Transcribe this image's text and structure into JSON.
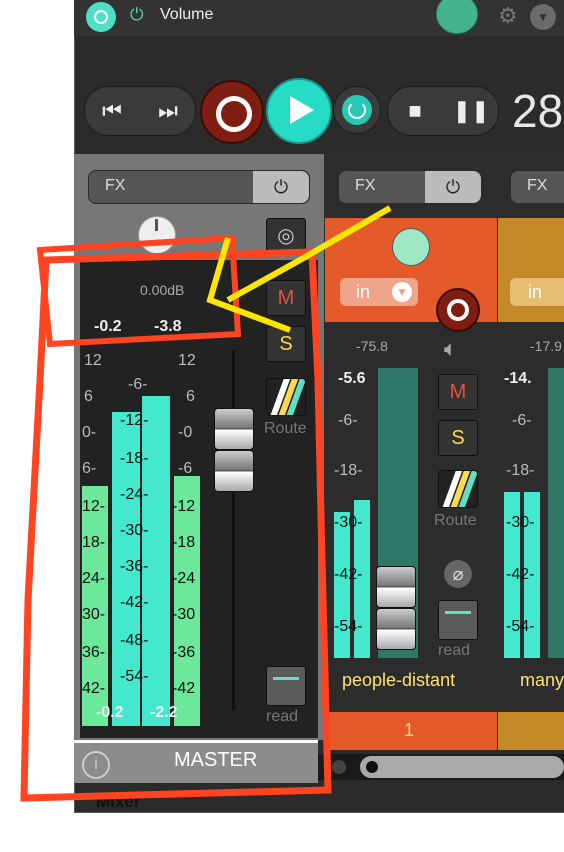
{
  "topbar": {
    "label": "Volume",
    "power_icon": "power-icon",
    "gear_icon": "gear-icon"
  },
  "transport": {
    "time": "28"
  },
  "master": {
    "fx_label": "FX",
    "db": "0.00dB",
    "peaks": [
      "-0.2",
      "-3.8"
    ],
    "bottom_peaks": [
      "-0.2",
      "-2.2"
    ],
    "mute": "M",
    "solo": "S",
    "route": "Route",
    "read": "read",
    "name": "MASTER"
  },
  "scale": {
    "left": [
      "12",
      "6",
      "0-",
      "6-",
      "12-",
      "18-",
      "24-",
      "30-",
      "36-",
      "42-"
    ],
    "right": [
      "12",
      "6",
      "-0",
      "-6",
      "-12",
      "-18",
      "-24",
      "-30",
      "-36",
      "-42"
    ],
    "mid": [
      "-6-",
      "-12-",
      "-18-",
      "-24-",
      "-30-",
      "-36-",
      "-42-",
      "-48-",
      "-54-"
    ]
  },
  "track1": {
    "fx_label": "FX",
    "in_label": "in",
    "db": "-75.8",
    "peak": "-5.6",
    "mute": "M",
    "solo": "S",
    "route": "Route",
    "read": "read",
    "name": "people-distant",
    "number": "1",
    "scale": [
      "-6-",
      "-18-",
      "-30-",
      "-42-",
      "-54-"
    ]
  },
  "track2": {
    "fx_label": "FX",
    "in_label": "in",
    "db": "-17.9",
    "peak": "-14.",
    "name": "many",
    "scale": [
      "-6-",
      "-18-",
      "-30-",
      "-42-",
      "-54-"
    ]
  },
  "bottom": {
    "mixer_tab": "Mixer"
  },
  "colors": {
    "accent": "#27dcc6",
    "record": "#7e1e12",
    "track1": "#e55a2b",
    "track2": "#c58a27",
    "annotation_red": "#ff4422",
    "annotation_yellow": "#ffe600"
  }
}
